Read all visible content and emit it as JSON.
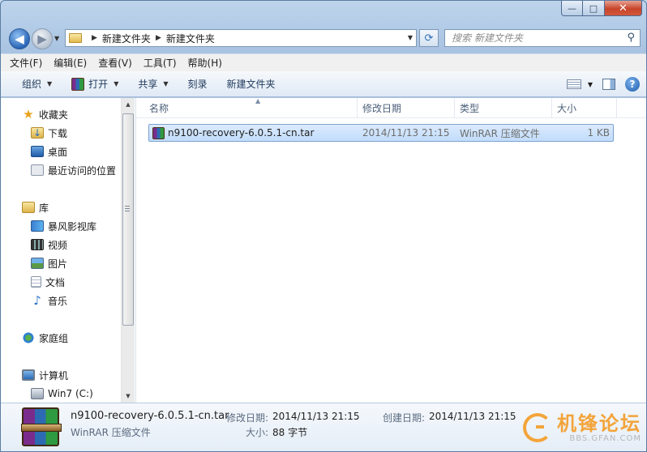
{
  "window": {
    "minimize_glyph": "—",
    "maximize_glyph": "□",
    "close_glyph": "✕"
  },
  "nav": {
    "back_glyph": "◀",
    "forward_glyph": "▶",
    "breadcrumb": [
      "新建文件夹",
      "新建文件夹"
    ],
    "refresh_glyph": "⟳",
    "search_placeholder": "搜索 新建文件夹",
    "search_icon": "magnifier-icon"
  },
  "menubar": [
    "文件(F)",
    "编辑(E)",
    "查看(V)",
    "工具(T)",
    "帮助(H)"
  ],
  "toolbar": {
    "organize": "组织",
    "open": "打开",
    "share": "共享",
    "burn": "刻录",
    "new_folder": "新建文件夹",
    "help_glyph": "?"
  },
  "navpane": {
    "favorites": "收藏夹",
    "downloads": "下载",
    "desktop": "桌面",
    "recent": "最近访问的位置",
    "libraries": "库",
    "baofeng": "暴风影视库",
    "videos": "视频",
    "pictures": "图片",
    "documents": "文档",
    "music": "音乐",
    "homegroup": "家庭组",
    "computer": "计算机",
    "drive_c": "Win7 (C:)"
  },
  "columns": {
    "name": "名称",
    "modified": "修改日期",
    "type": "类型",
    "size": "大小"
  },
  "files": [
    {
      "name": "n9100-recovery-6.0.5.1-cn.tar",
      "modified": "2014/11/13 21:15",
      "type": "WinRAR 压缩文件",
      "size": "1 KB"
    }
  ],
  "details": {
    "filename": "n9100-recovery-6.0.5.1-cn.tar",
    "filetype": "WinRAR 压缩文件",
    "modified_label": "修改日期:",
    "modified_value": "2014/11/13 21:15",
    "size_label": "大小:",
    "size_value": "88 字节",
    "created_label": "创建日期:",
    "created_value": "2014/11/13 21:15"
  },
  "watermark": {
    "text_cn": "机锋论坛",
    "text_en": "BBS.GFAN.COM"
  },
  "colors": {
    "accent": "#f3a43a",
    "selection": "#c1dcfc"
  }
}
